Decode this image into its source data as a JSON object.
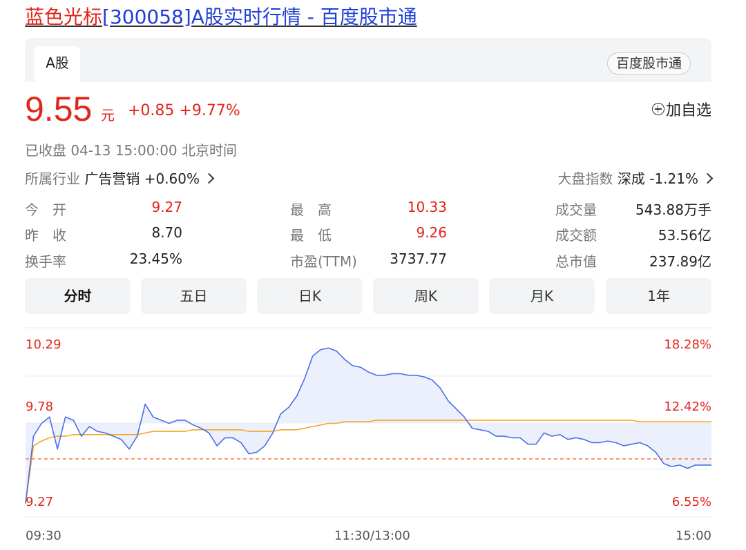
{
  "title": {
    "name": "蓝色光标",
    "rest": "[300058]A股实时行情 - 百度股市通"
  },
  "header": {
    "tab": "A股",
    "badge": "百度股市通"
  },
  "quote": {
    "price": "9.55",
    "unit": "元",
    "change": "+0.85 +9.77%",
    "watch_label": "加自选",
    "status": "已收盘  04-13 15:00:00  北京时间"
  },
  "industry": {
    "label": "所属行业",
    "name": "广告营销",
    "change": "+0.60%"
  },
  "index": {
    "label": "大盘指数",
    "name": "深成",
    "change": "-1.21%"
  },
  "stats": [
    {
      "label": "今　开",
      "value": "9.27"
    },
    {
      "label": "昨　收",
      "value": "8.70"
    },
    {
      "label": "换手率",
      "value": "23.45%"
    },
    {
      "label": "最　高",
      "value": "10.33"
    },
    {
      "label": "最　低",
      "value": "9.26"
    },
    {
      "label": "市盈(TTM)",
      "value": "3737.77"
    },
    {
      "label": "成交量",
      "value": "543.88万手"
    },
    {
      "label": "成交额",
      "value": "53.56亿"
    },
    {
      "label": "总市值",
      "value": "237.89亿"
    }
  ],
  "tabs": [
    "分时",
    "五日",
    "日K",
    "周K",
    "月K",
    "1年"
  ],
  "colors": {
    "up": "#e1251b",
    "price_line": "#4a6ee8",
    "avg_line": "#f5a623",
    "prev_close_line": "#f07a3a",
    "fill": "#e9edfb",
    "grid": "#ebebeb"
  },
  "chart_data": {
    "type": "line",
    "title": "",
    "ylim": [
      9.27,
      10.29
    ],
    "y_ticks_left": [
      "10.29",
      "9.78",
      "9.27"
    ],
    "y_ticks_right": [
      "18.28%",
      "12.42%",
      "6.55%"
    ],
    "x_ticks": [
      "09:30",
      "11:30/13:00",
      "15:00"
    ],
    "prev_close": 8.7,
    "series": [
      {
        "values": [
          9.28,
          9.7,
          9.78,
          9.82,
          9.62,
          9.82,
          9.8,
          9.7,
          9.76,
          9.73,
          9.72,
          9.7,
          9.68,
          9.62,
          9.7,
          9.9,
          9.82,
          9.8,
          9.78,
          9.8,
          9.8,
          9.77,
          9.75,
          9.72,
          9.64,
          9.69,
          9.69,
          9.66,
          9.59,
          9.6,
          9.64,
          9.72,
          9.84,
          9.88,
          9.95,
          10.06,
          10.2,
          10.24,
          10.25,
          10.23,
          10.18,
          10.14,
          10.13,
          10.1,
          10.08,
          10.08,
          10.09,
          10.09,
          10.08,
          10.08,
          10.07,
          10.05,
          10.0,
          9.92,
          9.87,
          9.82,
          9.75,
          9.74,
          9.73,
          9.7,
          9.7,
          9.69,
          9.69,
          9.65,
          9.65,
          9.72,
          9.7,
          9.71,
          9.68,
          9.69,
          9.68,
          9.66,
          9.66,
          9.67,
          9.66,
          9.64,
          9.65,
          9.66,
          9.64,
          9.6,
          9.53,
          9.51,
          9.52,
          9.5,
          9.52,
          9.52,
          9.52
        ]
      },
      {
        "values": [
          9.28,
          9.64,
          9.67,
          9.69,
          9.7,
          9.7,
          9.71,
          9.71,
          9.71,
          9.71,
          9.71,
          9.71,
          9.71,
          9.71,
          9.71,
          9.72,
          9.73,
          9.73,
          9.73,
          9.73,
          9.73,
          9.74,
          9.74,
          9.74,
          9.74,
          9.74,
          9.74,
          9.74,
          9.73,
          9.73,
          9.73,
          9.73,
          9.74,
          9.74,
          9.74,
          9.75,
          9.76,
          9.77,
          9.78,
          9.78,
          9.79,
          9.79,
          9.79,
          9.79,
          9.8,
          9.8,
          9.8,
          9.8,
          9.8,
          9.8,
          9.8,
          9.8,
          9.8,
          9.8,
          9.8,
          9.8,
          9.8,
          9.8,
          9.8,
          9.8,
          9.8,
          9.8,
          9.8,
          9.8,
          9.8,
          9.8,
          9.8,
          9.8,
          9.8,
          9.8,
          9.8,
          9.8,
          9.8,
          9.8,
          9.8,
          9.8,
          9.8,
          9.79,
          9.79,
          9.79,
          9.79,
          9.79,
          9.79,
          9.79,
          9.79,
          9.79,
          9.79
        ]
      }
    ]
  }
}
